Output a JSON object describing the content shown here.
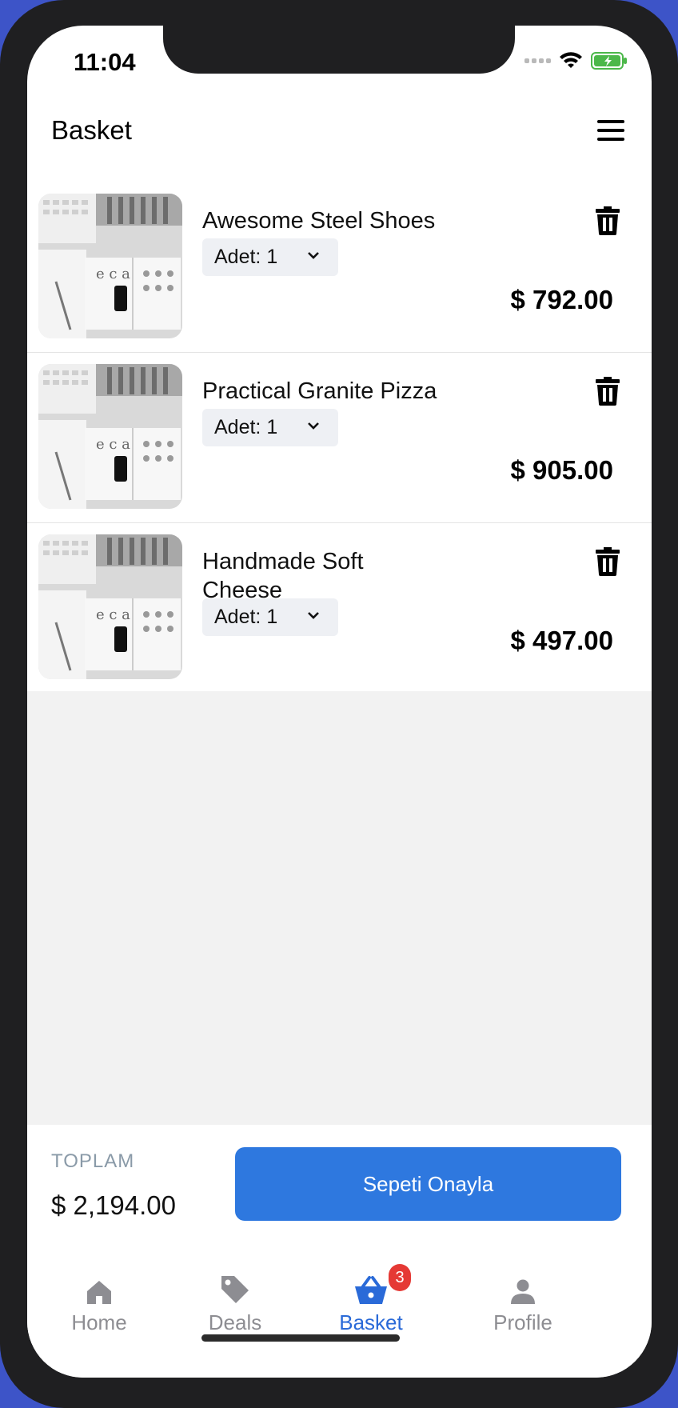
{
  "status_bar": {
    "time": "11:04"
  },
  "header": {
    "title": "Basket"
  },
  "basket_items": [
    {
      "name": "Awesome Steel Shoes",
      "quantity_label": "Adet: 1",
      "price": "$ 792.00"
    },
    {
      "name": "Practical Granite Pizza",
      "quantity_label": "Adet: 1",
      "price": "$ 905.00"
    },
    {
      "name": "Handmade Soft Cheese",
      "quantity_label": "Adet: 1",
      "price": "$ 497.00"
    }
  ],
  "checkout": {
    "total_label": "TOPLAM",
    "total_value": "$ 2,194.00",
    "confirm_label": "Sepeti Onayla"
  },
  "tab_bar": {
    "tabs": [
      {
        "label": "Home",
        "icon": "home-icon"
      },
      {
        "label": "Deals",
        "icon": "tag-icon"
      },
      {
        "label": "Basket",
        "icon": "basket-icon",
        "badge": "3",
        "active": true
      },
      {
        "label": "Profile",
        "icon": "person-icon"
      }
    ]
  },
  "colors": {
    "accent": "#2e78df",
    "active_tab": "#2a6ad8",
    "badge": "#e53935",
    "empty_area": "#f2f2f2"
  }
}
